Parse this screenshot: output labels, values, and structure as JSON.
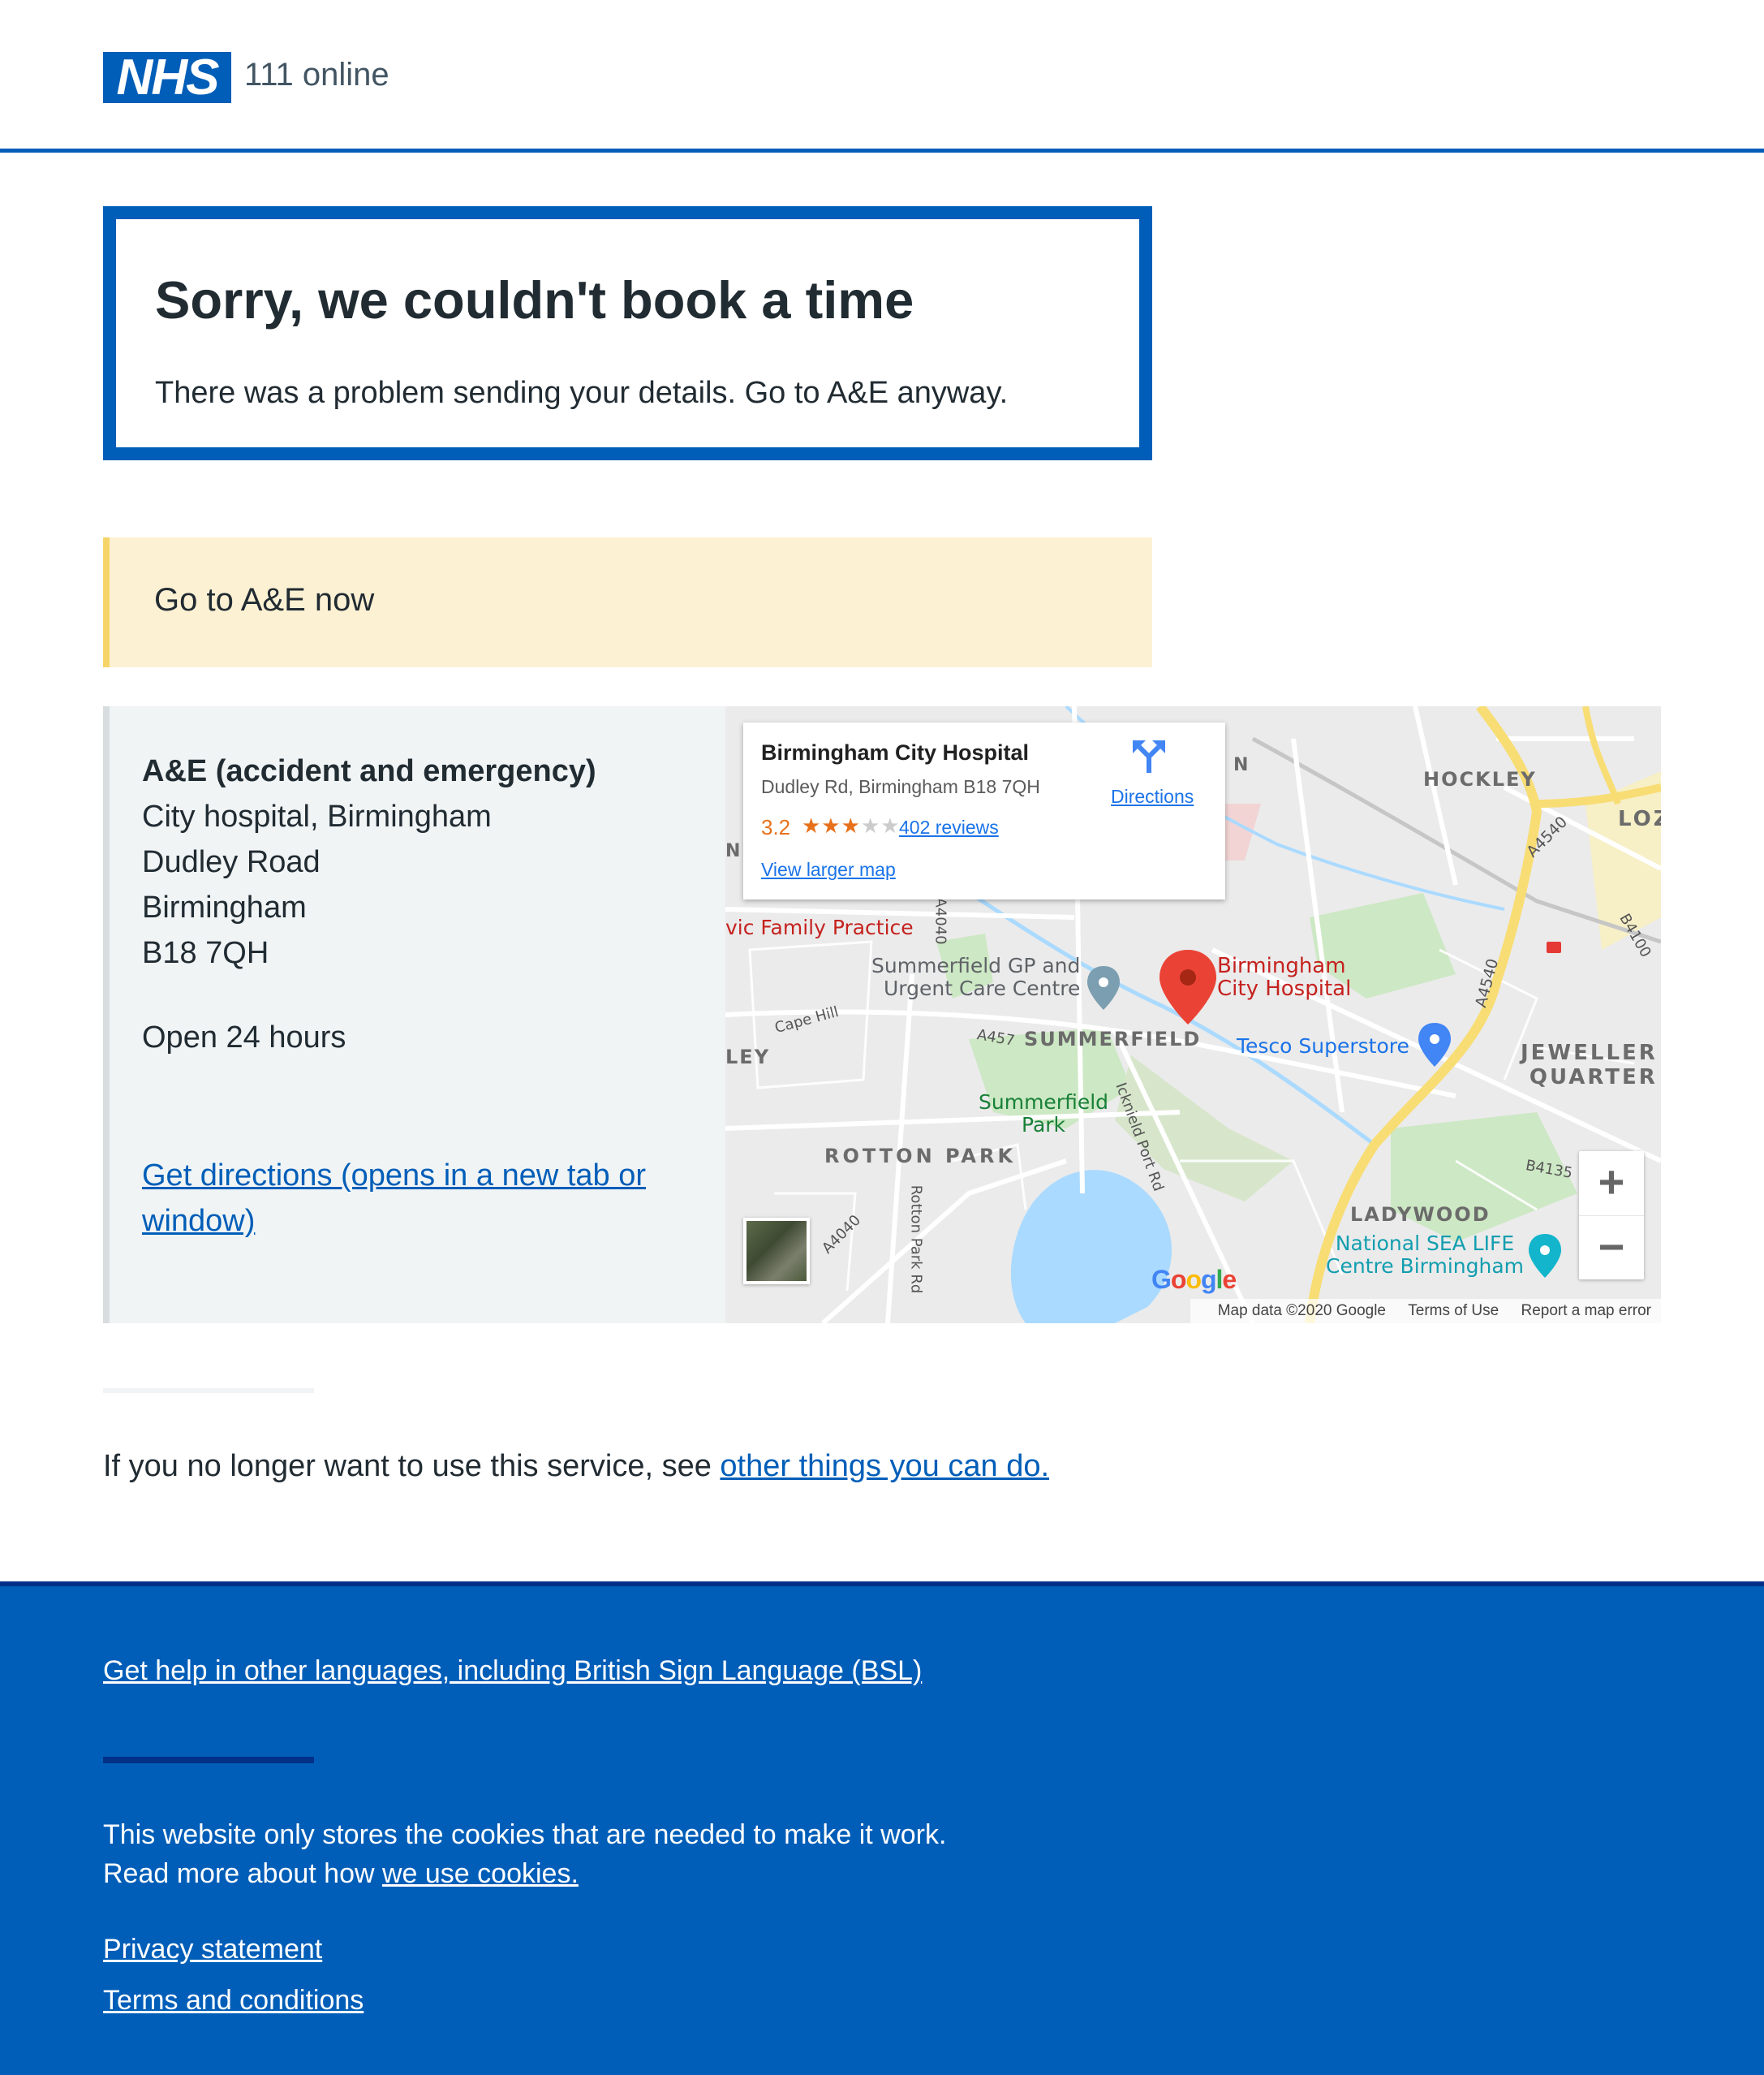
{
  "header": {
    "logo_text": "NHS",
    "service_name": "111 online"
  },
  "error": {
    "title": "Sorry, we couldn't book a time",
    "message": "There was a problem sending your details. Go to A&E anyway."
  },
  "callout": {
    "text": "Go to A&E now"
  },
  "service": {
    "name": "A&E (accident and emergency)",
    "address_lines": [
      "City hospital, Birmingham",
      "Dudley Road",
      "Birmingham",
      "B18 7QH"
    ],
    "hours": "Open 24 hours",
    "directions_link": "Get directions (opens in a new tab or window)"
  },
  "map": {
    "card": {
      "title": "Birmingham City Hospital",
      "address": "Dudley Rd, Birmingham B18 7QH",
      "rating": "3.2",
      "stars_filled": "★★★",
      "stars_empty": "★★",
      "reviews": "402 reviews",
      "larger_map": "View larger map",
      "directions": "Directions"
    },
    "labels": {
      "hockley": "HOCKLEY",
      "loz": "LOZ",
      "a4540_top": "A4540",
      "b4100": "B4100",
      "a4540_mid": "A4540",
      "family_practice": "vic Family Practice",
      "summerfield_gp_1": "Summerfield GP and",
      "summerfield_gp_2": "Urgent Care Centre",
      "hospital_1": "Birmingham",
      "hospital_2": "City Hospital",
      "cape_hill": "Cape Hill",
      "a457": "A457",
      "summerfield": "SUMMERFIELD",
      "tesco": "Tesco Superstore",
      "jewellery_1": "JEWELLER",
      "jewellery_2": "QUARTER",
      "ley": "LEY",
      "summerfield_park_1": "Summerfield",
      "summerfield_park_2": "Park",
      "icknield": "Icknield Port Rd",
      "rotton_park": "ROTTON PARK",
      "b4135": "B4135",
      "ladywood": "LADYWOOD",
      "sealife_1": "National SEA LIFE",
      "sealife_2": "Centre Birmingham",
      "a4040_left": "A4040",
      "a4040_top": "A4040",
      "rotton_park_rd": "Rotton Park Rd",
      "n_top": "N",
      "n_left": "N"
    },
    "zoom_in": "+",
    "zoom_out": "−",
    "google_logo": "Google",
    "attribution": "Map data ©2020 Google",
    "terms": "Terms of Use",
    "report": "Report a map error"
  },
  "exit": {
    "prefix": "If you no longer want to use this service, see ",
    "link": "other things you can do."
  },
  "footer": {
    "languages_link": "Get help in other languages, including British Sign Language (BSL)",
    "cookies_line1": "This website only stores the cookies that are needed to make it work.",
    "cookies_line2_prefix": "Read more about how ",
    "cookies_link": "we use cookies.",
    "privacy": "Privacy statement",
    "terms": "Terms and conditions"
  },
  "colors": {
    "nhs_blue": "#005eb8",
    "nhs_dark_blue": "#003087",
    "warning_bg": "#fdf1d3",
    "grey_bg": "#f0f4f5",
    "marker_red": "#ea4335"
  }
}
